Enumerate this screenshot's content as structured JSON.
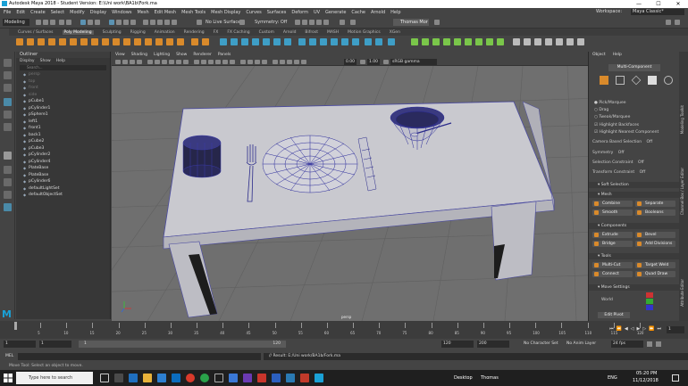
{
  "window": {
    "title": "Autodesk Maya 2018 - Student Version: E:\\Uni work\\BA1b\\Fork.ma"
  },
  "menubar": {
    "items": [
      "File",
      "Edit",
      "Create",
      "Select",
      "Modify",
      "Display",
      "Windows",
      "Mesh",
      "Edit Mesh",
      "Mesh Tools",
      "Mesh Display",
      "Curves",
      "Surfaces",
      "Deform",
      "UV",
      "Generate",
      "Cache",
      "Arnold",
      "Help"
    ],
    "workspace_label": "Workspace:",
    "workspace_value": "Maya Classic*"
  },
  "statusline": {
    "mode": "Modeling",
    "live_surface": "No Live Surface",
    "symmetry": "Symmetry: Off",
    "user": "Thomas Mor"
  },
  "shelf": {
    "tabs": [
      "Curves / Surfaces",
      "Poly Modeling",
      "Sculpting",
      "Rigging",
      "Animation",
      "Rendering",
      "FX",
      "FX Caching",
      "Custom",
      "Arnold",
      "Bifrost",
      "MASH",
      "Motion Graphics",
      "XGen"
    ],
    "active_tab": "Poly Modeling"
  },
  "outliner": {
    "title": "Outliner",
    "menus": [
      "Display",
      "Show",
      "Help"
    ],
    "search_placeholder": "Search...",
    "items": [
      "persp",
      "top",
      "front",
      "side",
      "pCube1",
      "pCylinder1",
      "pSphere1",
      "left1",
      "front1",
      "back1",
      "pCube2",
      "pCube3",
      "pCylinder2",
      "pCylinder4",
      "PlateBase",
      "PlateBase",
      "pCylinder6",
      "defaultLightSet",
      "defaultObjectSet"
    ],
    "dim_items": [
      0,
      1,
      2,
      3
    ]
  },
  "viewport": {
    "menus": [
      "View",
      "Shading",
      "Lighting",
      "Show",
      "Renderer",
      "Panels"
    ],
    "field_a": "0.00",
    "field_b": "1.00",
    "color_space": "sRGB gamma",
    "camera_label": "persp"
  },
  "rightpanel": {
    "tabs": [
      "Object",
      "Help"
    ],
    "title": "Multi-Component",
    "options": [
      "Pick/Marquee",
      "Drag",
      "Tweak/Marquee"
    ],
    "checks": [
      "Highlight Backfaces",
      "Highlight Nearest Component"
    ],
    "camera_based": "Camera Based Selection",
    "camera_based_val": "Off",
    "symmetry": "Symmetry",
    "symmetry_val": "Off",
    "sel_constraint": "Selection Constraint",
    "sel_constraint_val": "Off",
    "xform_constraint": "Transform Constraint",
    "xform_constraint_val": "Off",
    "soft_selection": "Soft Selection",
    "mesh_section": "Mesh",
    "mesh_buttons": [
      "Combine",
      "Separate",
      "Smooth",
      "Booleans"
    ],
    "components_section": "Components",
    "component_buttons": [
      "Extrude",
      "Bevel",
      "Bridge",
      "Add Divisions"
    ],
    "tools_section": "Tools",
    "tool_buttons": [
      "Multi-Cut",
      "Target Weld",
      "Connect",
      "Quad Draw"
    ],
    "move_section": "Move Settings",
    "world_label": "World",
    "edit_pivot": "Edit Pivot"
  },
  "sidetabs": [
    "Modeling Toolkit",
    "Channel Box / Layer Editor",
    "Attribute Editor"
  ],
  "timeline": {
    "ticks": [
      "5",
      "10",
      "15",
      "20",
      "25",
      "30",
      "35",
      "40",
      "45",
      "50",
      "55",
      "60",
      "65",
      "70",
      "75",
      "80",
      "85",
      "90",
      "95",
      "100",
      "105",
      "110",
      "115",
      "120"
    ],
    "current": "1"
  },
  "range": {
    "start": "1",
    "start2": "1",
    "slider_left": "1",
    "slider_right": "120",
    "end": "120",
    "end2": "200",
    "character_set": "No Character Set",
    "anim_layer": "No Anim Layer",
    "fps": "24 fps"
  },
  "cmdline": {
    "label": "MEL",
    "result": "// Result: E:/Uni work/BA1b/Fork.ma"
  },
  "helpline": "Move Tool: Select an object to move.",
  "taskbar": {
    "search_placeholder": "Type here to search",
    "desktop": "Desktop",
    "user": "Thomas",
    "time": "05:20 PM",
    "date": "11/12/2018",
    "lang": "ENG"
  }
}
